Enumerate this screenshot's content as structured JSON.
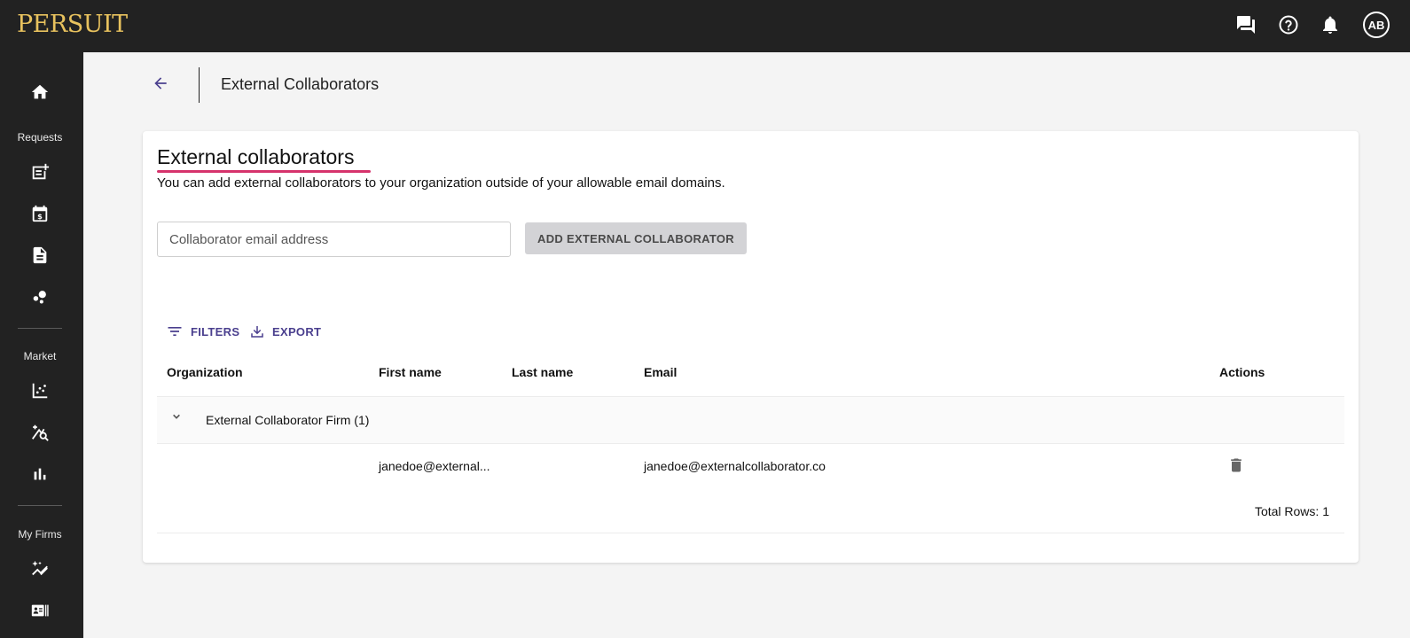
{
  "app": {
    "logo": "PERSUIT",
    "avatar_initials": "AB"
  },
  "header": {
    "title": "External Collaborators"
  },
  "sidebar": {
    "sections": {
      "requests": "Requests",
      "market": "Market",
      "my_firms": "My Firms"
    }
  },
  "card": {
    "title": "External collaborators",
    "description": "You can add external collaborators to your organization outside of your allowable email domains.",
    "email_placeholder": "Collaborator email address",
    "add_button": "ADD EXTERNAL COLLABORATOR"
  },
  "toolbar": {
    "filters": "FILTERS",
    "export": "EXPORT"
  },
  "table": {
    "columns": {
      "organization": "Organization",
      "first_name": "First name",
      "last_name": "Last name",
      "email": "Email",
      "actions": "Actions"
    },
    "group": {
      "label": "External Collaborator Firm (1)"
    },
    "rows": [
      {
        "first_name": "janedoe@external...",
        "last_name": "",
        "email": "janedoe@externalcollaborator.co"
      }
    ],
    "total_rows": "Total Rows: 1"
  },
  "colors": {
    "accent": "#4a3f8e",
    "underline": "#d6336c",
    "logo": "#e8c25e",
    "chrome": "#222222"
  }
}
